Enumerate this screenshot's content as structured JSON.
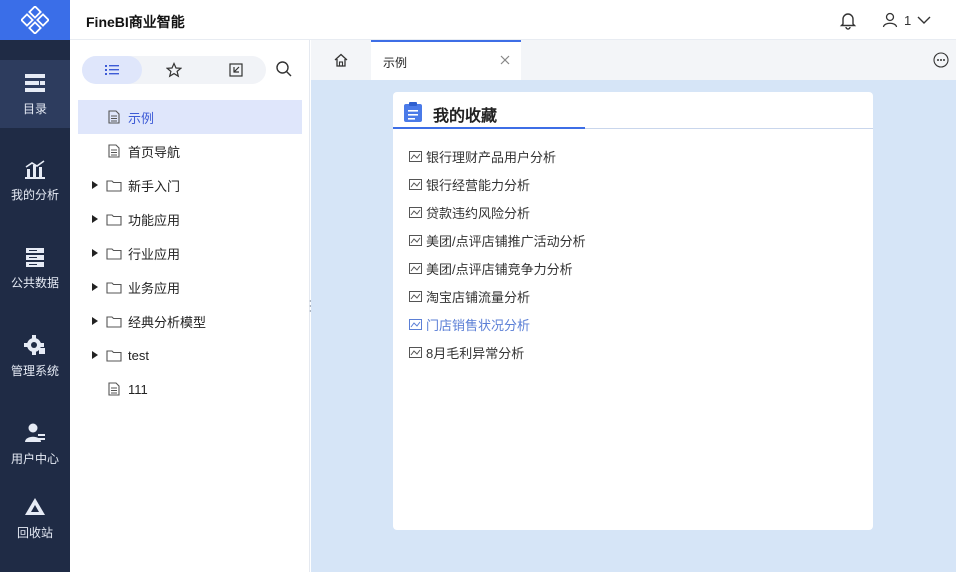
{
  "header": {
    "title": "FineBI商业智能",
    "user_name": "1"
  },
  "leftnav": {
    "items": [
      {
        "label": "目录",
        "icon": "catalog-icon"
      },
      {
        "label": "我的分析",
        "icon": "analysis-icon"
      },
      {
        "label": "公共数据",
        "icon": "database-icon"
      },
      {
        "label": "管理系统",
        "icon": "gear-icon"
      },
      {
        "label": "用户中心",
        "icon": "user-center-icon"
      },
      {
        "label": "回收站",
        "icon": "recycle-icon"
      }
    ]
  },
  "directory": {
    "tabs": [
      {
        "icon": "list-icon"
      },
      {
        "icon": "star-icon"
      },
      {
        "icon": "export-icon"
      }
    ],
    "items": [
      {
        "label": "示例",
        "type": "file"
      },
      {
        "label": "首页导航",
        "type": "file"
      },
      {
        "label": "新手入门",
        "type": "folder"
      },
      {
        "label": "功能应用",
        "type": "folder"
      },
      {
        "label": "行业应用",
        "type": "folder"
      },
      {
        "label": "业务应用",
        "type": "folder"
      },
      {
        "label": "经典分析模型",
        "type": "folder"
      },
      {
        "label": "test",
        "type": "folder"
      },
      {
        "label": "111",
        "type": "file"
      }
    ]
  },
  "tabs": {
    "active_label": "示例"
  },
  "card": {
    "title": "我的收藏",
    "items": [
      "银行理财产品用户分析",
      "银行经营能力分析",
      "贷款违约风险分析",
      "美团/点评店铺推广活动分析",
      "美团/点评店铺竞争力分析",
      "淘宝店铺流量分析",
      "门店销售状况分析",
      "8月毛利异常分析"
    ]
  },
  "colors": {
    "accent": "#3d6ee6",
    "nav_bg": "#1f2b45",
    "main_bg": "#d6e5f7"
  }
}
